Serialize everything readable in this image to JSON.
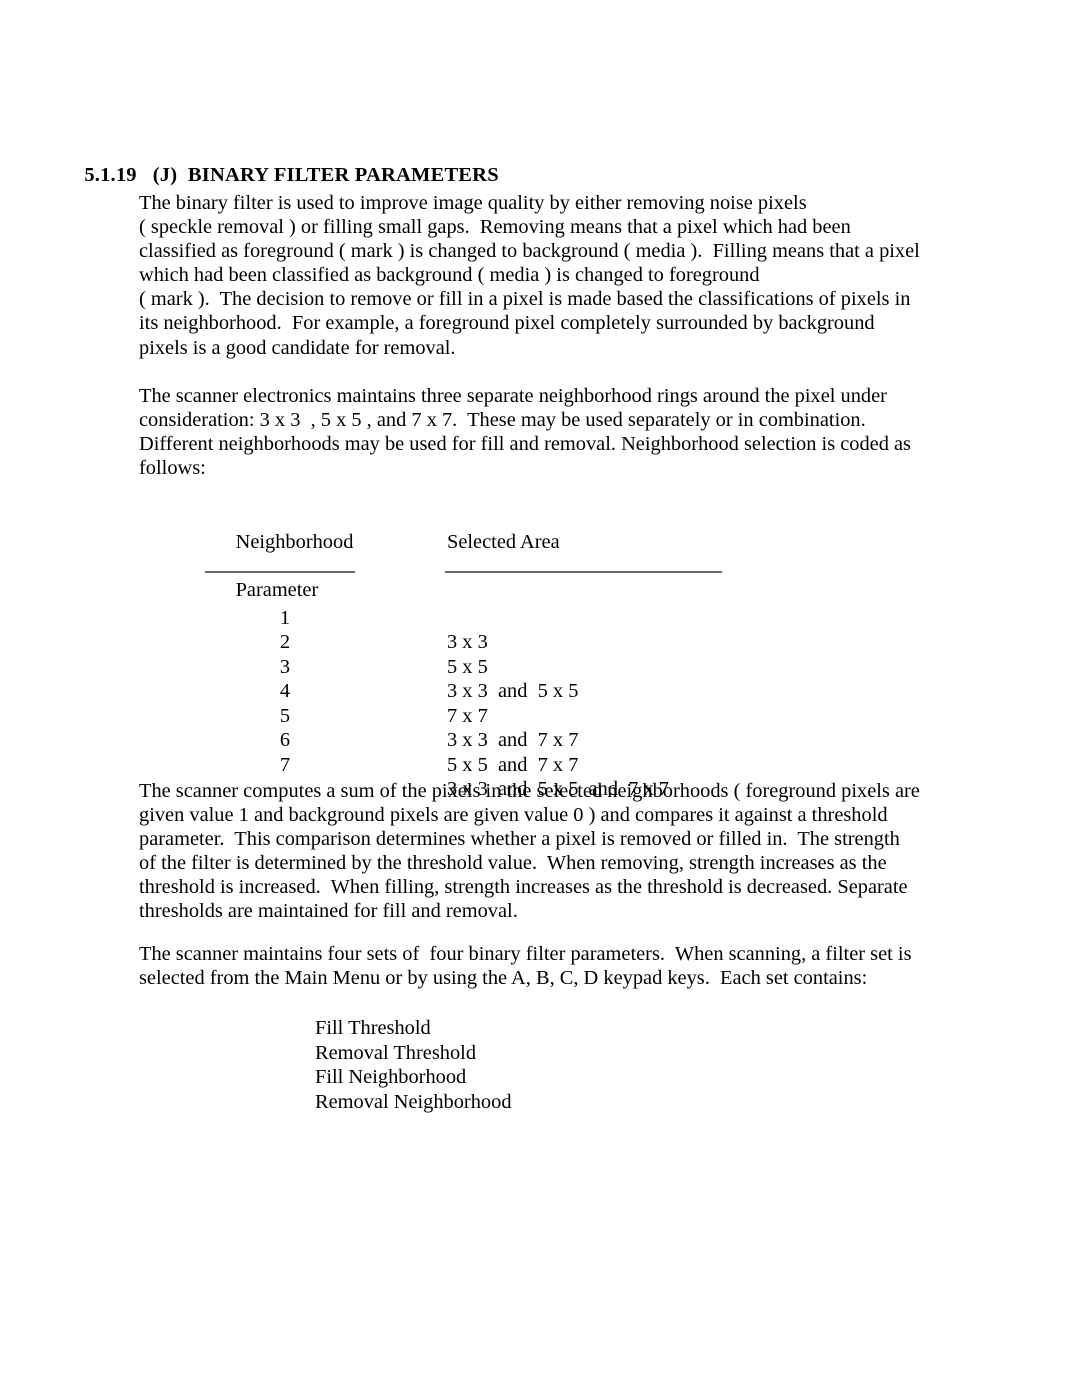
{
  "section": {
    "number": "5.1.19",
    "letter": "(J)",
    "title": "BINARY FILTER PARAMETERS"
  },
  "paragraphs": {
    "intro": [
      "The binary filter is used to improve image quality by either removing noise pixels",
      "( speckle removal ) or filling small gaps.  Removing means that a pixel which had been",
      "classified as foreground ( mark ) is changed to background ( media ).  Filling means that a pixel",
      "which had been classified as background ( media ) is changed to foreground",
      "( mark ).  The decision to remove or fill in a pixel is made based the classifications of pixels in",
      "its neighborhood.  For example, a foreground pixel completely surrounded by background",
      "pixels is a good candidate for removal."
    ],
    "rings": [
      "The scanner electronics maintains three separate neighborhood rings around the pixel under",
      "consideration: 3 x 3  , 5 x 5 , and 7 x 7.  These may be used separately or in combination.",
      "Different neighborhoods may be used for fill and removal. Neighborhood selection is coded as",
      "follows:"
    ],
    "sum": [
      "The scanner computes a sum of the pixels in the selected neighborhoods ( foreground pixels are",
      "given value 1 and background pixels are given value 0 ) and compares it against a threshold",
      "parameter.  This comparison determines whether a pixel is removed or filled in.  The strength",
      "of the filter is determined by the threshold value.  When removing, strength increases as the",
      "threshold is increased.  When filling, strength increases as the threshold is decreased. Separate",
      "thresholds are maintained for fill and removal."
    ],
    "sets": [
      "The scanner maintains four sets of  four binary filter parameters.  When scanning, a filter set is",
      "selected from the Main Menu or by using the A, B, C, D keypad keys.  Each set contains:"
    ]
  },
  "table": {
    "header_param_line1": "Neighborhood",
    "header_param_line2": "Parameter",
    "header_area": "Selected Area",
    "rows": [
      {
        "parameter": "1",
        "area": "3 x 3"
      },
      {
        "parameter": "2",
        "area": "5 x 5"
      },
      {
        "parameter": "3",
        "area": "3 x 3  and  5 x 5"
      },
      {
        "parameter": "4",
        "area": "7 x 7"
      },
      {
        "parameter": "5",
        "area": "3 x 3  and  7 x 7"
      },
      {
        "parameter": "6",
        "area": "5 x 5  and  7 x 7"
      },
      {
        "parameter": "7",
        "area": "3 x 3  and  5 x 5  and  7 x 7"
      }
    ]
  },
  "parameter_list": [
    "Fill Threshold",
    "Removal Threshold",
    "Fill Neighborhood",
    "Removal Neighborhood"
  ]
}
